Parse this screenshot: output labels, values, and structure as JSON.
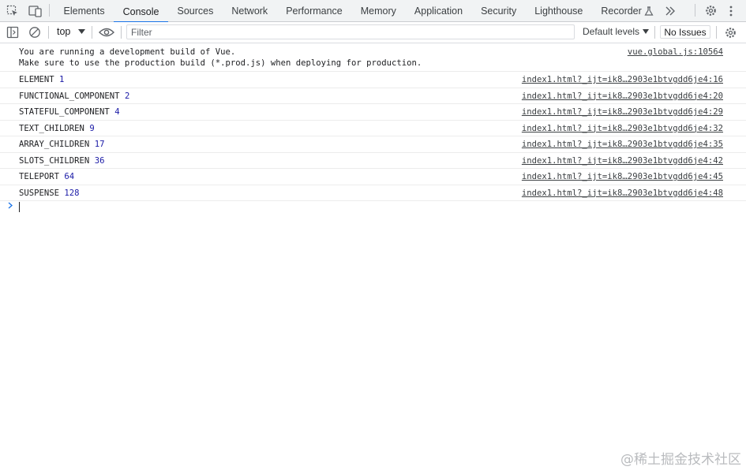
{
  "tabs": [
    "Elements",
    "Console",
    "Sources",
    "Network",
    "Performance",
    "Memory",
    "Application",
    "Security",
    "Lighthouse",
    "Recorder"
  ],
  "active_tab": "Console",
  "toolbar": {
    "context": "top",
    "filter_placeholder": "Filter",
    "levels": "Default levels",
    "issues": "No Issues"
  },
  "vue_warning": {
    "line1": "You are running a development build of Vue.",
    "line2": "Make sure to use the production build (*.prod.js) when deploying for production.",
    "source": "vue.global.js:10564"
  },
  "logs": [
    {
      "label": "ELEMENT",
      "value": "1",
      "source": "index1.html?_ijt=ik8…2903e1btvgdd6je4:16"
    },
    {
      "label": "FUNCTIONAL_COMPONENT",
      "value": "2",
      "source": "index1.html?_ijt=ik8…2903e1btvgdd6je4:20"
    },
    {
      "label": "STATEFUL_COMPONENT",
      "value": "4",
      "source": "index1.html?_ijt=ik8…2903e1btvgdd6je4:29"
    },
    {
      "label": "TEXT_CHILDREN",
      "value": "9",
      "source": "index1.html?_ijt=ik8…2903e1btvgdd6je4:32"
    },
    {
      "label": "ARRAY_CHILDREN",
      "value": "17",
      "source": "index1.html?_ijt=ik8…2903e1btvgdd6je4:35"
    },
    {
      "label": "SLOTS_CHILDREN",
      "value": "36",
      "source": "index1.html?_ijt=ik8…2903e1btvgdd6je4:42"
    },
    {
      "label": "TELEPORT",
      "value": "64",
      "source": "index1.html?_ijt=ik8…2903e1btvgdd6je4:45"
    },
    {
      "label": "SUSPENSE",
      "value": "128",
      "source": "index1.html?_ijt=ik8…2903e1btvgdd6je4:48"
    }
  ],
  "watermark": "@稀土掘金技术社区"
}
